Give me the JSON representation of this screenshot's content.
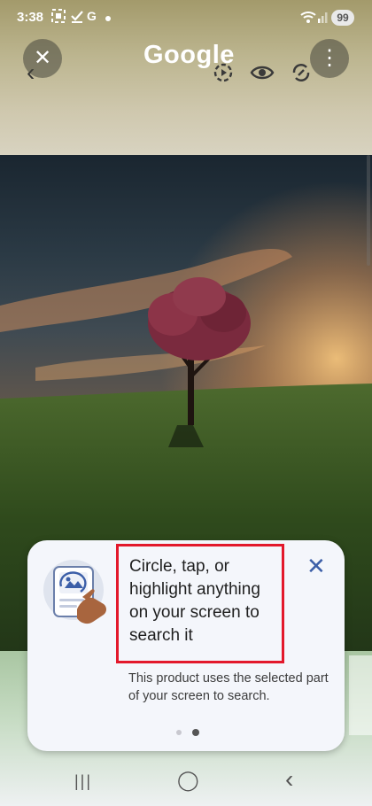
{
  "status_bar": {
    "time": "3:38",
    "icons": [
      "screenshot-icon",
      "download-icon",
      "google-g-icon",
      "dot-icon"
    ],
    "g_label": "G",
    "battery": "99"
  },
  "top_bar": {
    "logo": "Google",
    "close_glyph": "✕",
    "more_glyph": "⋮"
  },
  "card": {
    "headline": "Circle, tap, or highlight anything on your screen to search it",
    "subtext": "This product uses the selected part of your screen to search.",
    "close_glyph": "✕",
    "page_count": 2,
    "active_page": 2
  },
  "nav_bar": {
    "recents_glyph": "|||",
    "home_glyph": "◯",
    "back_glyph": "‹"
  },
  "colors": {
    "highlight_border": "#e3182b",
    "close_accent": "#3c5fa8",
    "card_background": "#f4f6fb"
  }
}
